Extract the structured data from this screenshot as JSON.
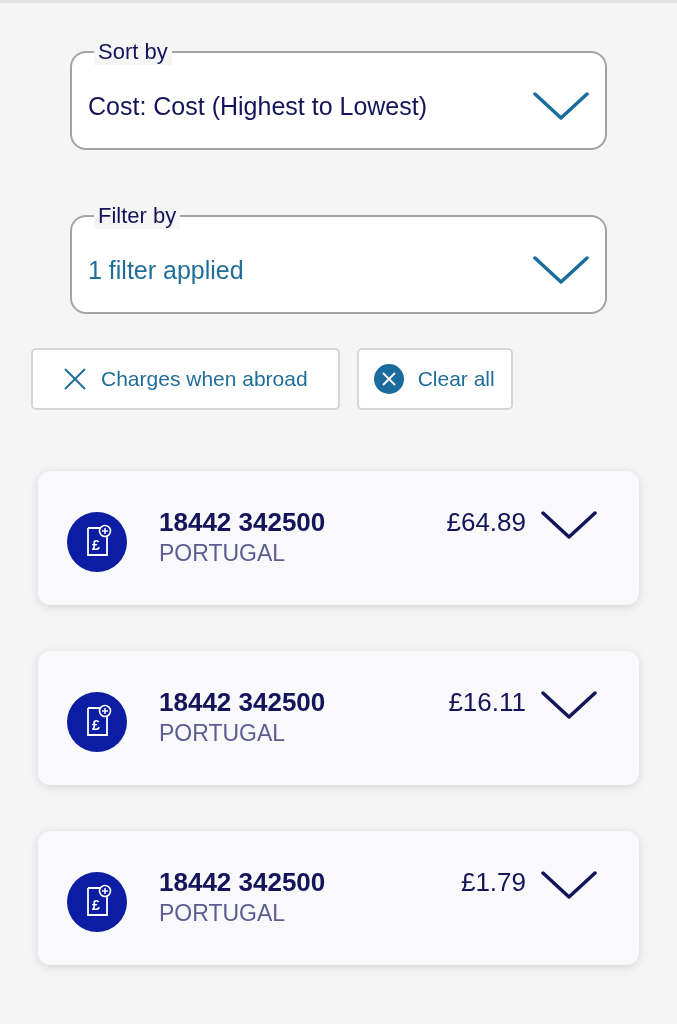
{
  "sort": {
    "label": "Sort by",
    "value": "Cost: Cost (Highest to Lowest)"
  },
  "filter": {
    "label": "Filter by",
    "value": "1 filter applied"
  },
  "chips": [
    {
      "kind": "remove",
      "label": "Charges when abroad"
    },
    {
      "kind": "clear",
      "label": "Clear all"
    }
  ],
  "charges": [
    {
      "icon_glyph": "£",
      "number": "18442 342500",
      "country": "PORTUGAL",
      "amount": "£64.89",
      "expanded": false
    },
    {
      "icon_glyph": "£",
      "number": "18442 342500",
      "country": "PORTUGAL",
      "amount": "£16.11",
      "expanded": false
    },
    {
      "icon_glyph": "£",
      "number": "18442 342500",
      "country": "PORTUGAL",
      "amount": "£1.79",
      "expanded": false
    }
  ]
}
